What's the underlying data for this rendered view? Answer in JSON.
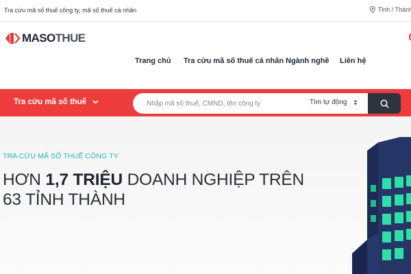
{
  "topbar": {
    "tagline": "Tra cứu mã số thuế công ty, mã số thuế cá nhân",
    "region": "Tỉnh / Thành",
    "region_icon": "map-pin-icon"
  },
  "brand": {
    "logo_part1": "MASO",
    "logo_part2": "THUE",
    "accent": "#e63a3a",
    "dark": "#1e2430"
  },
  "nav": {
    "items": [
      {
        "label": "Trang chủ"
      },
      {
        "label": "Tra cứu mã số thuế cá nhân"
      },
      {
        "label": "Ngành nghề"
      },
      {
        "label": "Liên hệ"
      }
    ]
  },
  "search": {
    "dropdown_label": "Tra cứu mã số thuế",
    "placeholder": "Nhập mã số thuế, CMND, tên công ty",
    "mode_label": "Tìm tự động",
    "button_icon": "search-icon",
    "bar_color": "#ee3b3b",
    "button_color": "#2d3440"
  },
  "hero": {
    "label": "TRA CỨU MÃ SỐ THUẾ CÔNG TY",
    "title_prefix": "HƠN ",
    "title_highlight": "1,7 TRIỆU",
    "title_suffix": " DOANH NGHIỆP TRÊN",
    "title_line2": "63 TỈNH THÀNH",
    "label_color": "#23b3c9"
  }
}
